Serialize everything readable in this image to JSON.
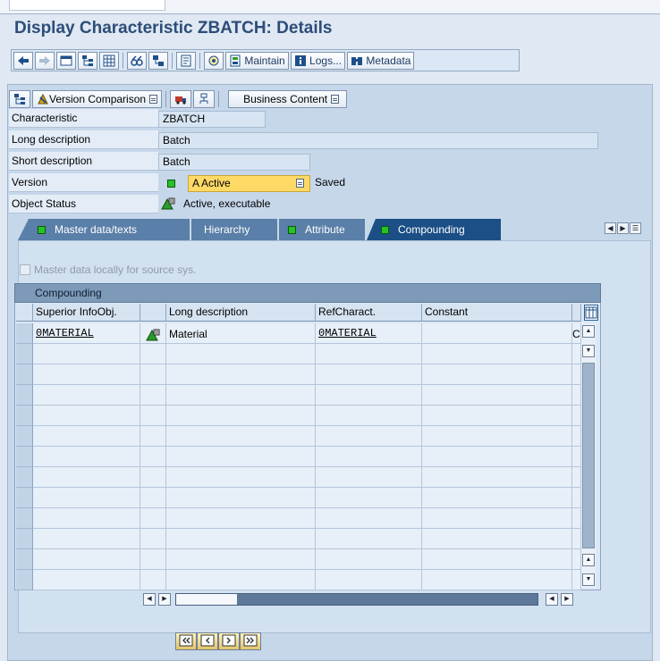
{
  "title": "Display Characteristic ZBATCH: Details",
  "toolbar": {
    "maintain": "Maintain",
    "logs": "Logs...",
    "metadata": "Metadata"
  },
  "func_bar": {
    "version_comparison": "Version Comparison",
    "business_content": "Business Content"
  },
  "fields": {
    "characteristic": {
      "label": "Characteristic",
      "value": "ZBATCH"
    },
    "long_description": {
      "label": "Long description",
      "value": "Batch"
    },
    "short_description": {
      "label": "Short description",
      "value": "Batch"
    },
    "version": {
      "label": "Version",
      "value": "A Active",
      "status": "Saved"
    },
    "object_status": {
      "label": "Object Status",
      "value": "Active, executable"
    }
  },
  "tabs": [
    {
      "label": "Master data/texts",
      "active": false
    },
    {
      "label": "Hierarchy",
      "active": false
    },
    {
      "label": "Attribute",
      "active": false
    },
    {
      "label": "Compounding",
      "active": true
    }
  ],
  "master_data_checkbox": {
    "label": "Master data locally for source sys.",
    "checked": false,
    "enabled": false
  },
  "grid": {
    "title": "Compounding",
    "columns": [
      "Superior InfoObj.",
      "",
      "Long description",
      "RefCharact.",
      "Constant"
    ],
    "rows": [
      {
        "superior": "0MATERIAL",
        "description": "Material",
        "ref": "0MATERIAL",
        "constant": "C"
      }
    ],
    "empty_rows": 12
  },
  "colors": {
    "title": "#2d4d78",
    "tab_active": "#1b4f85",
    "tab_inactive": "#5a7fa8",
    "status_green": "#27c227",
    "version_bg": "#ffd966"
  }
}
